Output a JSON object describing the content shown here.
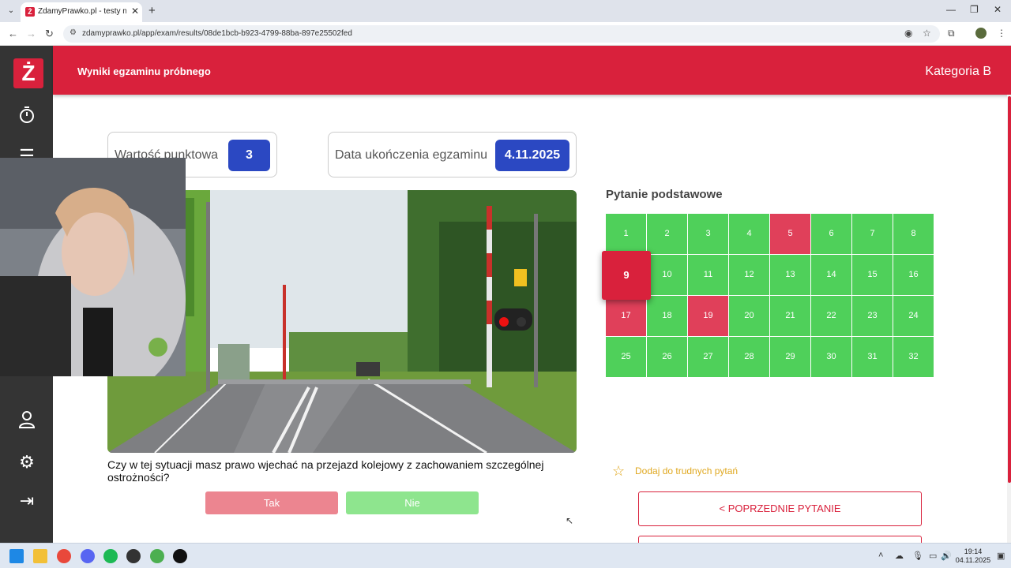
{
  "browser": {
    "tab_title": "ZdamyPrawko.pl - testy na prawo jazdy",
    "url": "zdamyprawko.pl/app/exam/results/08de1bcb-b923-4799-88ba-897e25502fed",
    "favicon_letter": "Ż"
  },
  "sidebar": {
    "logo": "Ż",
    "items": [
      {
        "icon": "stopwatch-icon"
      },
      {
        "icon": "list-icon"
      },
      {
        "icon": "user-icon"
      },
      {
        "icon": "gear-icon"
      },
      {
        "icon": "logout-icon"
      }
    ]
  },
  "header": {
    "title": "Wyniki egzaminu próbnego",
    "category": "Kategoria B"
  },
  "info": {
    "points_label": "Wartość punktowa",
    "points_value": "3",
    "date_label": "Data ukończenia egzaminu",
    "date_value": "4.11.2025"
  },
  "question": {
    "text": "Czy w tej sytuacji masz prawo wjechać na przejazd kolejowy z zachowaniem szczególnej ostrożności?",
    "answer_yes": "Tak",
    "answer_no": "Nie"
  },
  "grid": {
    "title": "Pytanie podstawowe",
    "current": 9,
    "cells": [
      {
        "n": "1",
        "s": "ok"
      },
      {
        "n": "2",
        "s": "ok"
      },
      {
        "n": "3",
        "s": "ok"
      },
      {
        "n": "4",
        "s": "ok"
      },
      {
        "n": "5",
        "s": "bad"
      },
      {
        "n": "6",
        "s": "ok"
      },
      {
        "n": "7",
        "s": "ok"
      },
      {
        "n": "8",
        "s": "ok"
      },
      {
        "n": "9",
        "s": "bad"
      },
      {
        "n": "10",
        "s": "ok"
      },
      {
        "n": "11",
        "s": "ok"
      },
      {
        "n": "12",
        "s": "ok"
      },
      {
        "n": "13",
        "s": "ok"
      },
      {
        "n": "14",
        "s": "ok"
      },
      {
        "n": "15",
        "s": "ok"
      },
      {
        "n": "16",
        "s": "ok"
      },
      {
        "n": "17",
        "s": "bad"
      },
      {
        "n": "18",
        "s": "ok"
      },
      {
        "n": "19",
        "s": "bad"
      },
      {
        "n": "20",
        "s": "ok"
      },
      {
        "n": "21",
        "s": "ok"
      },
      {
        "n": "22",
        "s": "ok"
      },
      {
        "n": "23",
        "s": "ok"
      },
      {
        "n": "24",
        "s": "ok"
      },
      {
        "n": "25",
        "s": "ok"
      },
      {
        "n": "26",
        "s": "ok"
      },
      {
        "n": "27",
        "s": "ok"
      },
      {
        "n": "28",
        "s": "ok"
      },
      {
        "n": "29",
        "s": "ok"
      },
      {
        "n": "30",
        "s": "ok"
      },
      {
        "n": "31",
        "s": "ok"
      },
      {
        "n": "32",
        "s": "ok"
      }
    ]
  },
  "actions": {
    "favorite_label": "Dodaj do trudnych pytań",
    "prev_label": "< POPRZEDNIE PYTANIE"
  },
  "taskbar": {
    "time": "19:14",
    "date": "04.11.2025"
  },
  "colors": {
    "brand_red": "#d9213c",
    "correct_green": "#4fd05a",
    "wrong_red": "#e0405a",
    "value_blue": "#2b48c2"
  }
}
